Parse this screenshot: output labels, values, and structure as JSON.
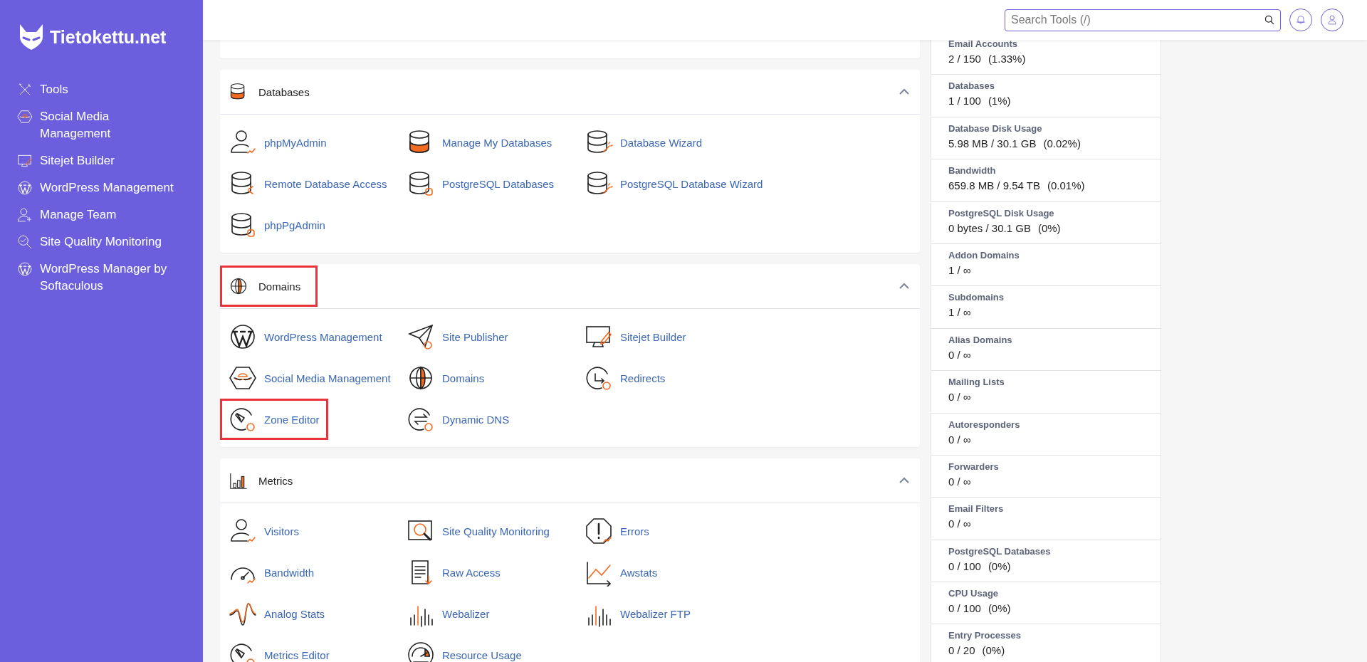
{
  "brand": {
    "name": "Tietokettu.net"
  },
  "sidebar": {
    "items": [
      {
        "label": "Tools"
      },
      {
        "label": "Social Media Management"
      },
      {
        "label": "Sitejet Builder"
      },
      {
        "label": "WordPress Management"
      },
      {
        "label": "Manage Team"
      },
      {
        "label": "Site Quality Monitoring"
      },
      {
        "label": "WordPress Manager by Softaculous"
      }
    ]
  },
  "search": {
    "placeholder": "Search Tools (/)"
  },
  "sections": [
    {
      "title": "Databases",
      "expanded": true,
      "highlighted": false,
      "items": [
        {
          "label": "phpMyAdmin",
          "highlighted": false
        },
        {
          "label": "Manage My Databases",
          "highlighted": false
        },
        {
          "label": "Database Wizard",
          "highlighted": false
        },
        {
          "label": "Remote Database Access",
          "highlighted": false
        },
        {
          "label": "PostgreSQL Databases",
          "highlighted": false
        },
        {
          "label": "PostgreSQL Database Wizard",
          "highlighted": false
        },
        {
          "label": "phpPgAdmin",
          "highlighted": false
        }
      ]
    },
    {
      "title": "Domains",
      "expanded": true,
      "highlighted": true,
      "items": [
        {
          "label": "WordPress Management",
          "highlighted": false
        },
        {
          "label": "Site Publisher",
          "highlighted": false
        },
        {
          "label": "Sitejet Builder",
          "highlighted": false
        },
        {
          "label": "Social Media Management",
          "highlighted": false
        },
        {
          "label": "Domains",
          "highlighted": false
        },
        {
          "label": "Redirects",
          "highlighted": false
        },
        {
          "label": "Zone Editor",
          "highlighted": true
        },
        {
          "label": "Dynamic DNS",
          "highlighted": false
        }
      ]
    },
    {
      "title": "Metrics",
      "expanded": true,
      "highlighted": false,
      "items": [
        {
          "label": "Visitors",
          "highlighted": false
        },
        {
          "label": "Site Quality Monitoring",
          "highlighted": false
        },
        {
          "label": "Errors",
          "highlighted": false
        },
        {
          "label": "Bandwidth",
          "highlighted": false
        },
        {
          "label": "Raw Access",
          "highlighted": false
        },
        {
          "label": "Awstats",
          "highlighted": false
        },
        {
          "label": "Analog Stats",
          "highlighted": false
        },
        {
          "label": "Webalizer",
          "highlighted": false
        },
        {
          "label": "Webalizer FTP",
          "highlighted": false
        },
        {
          "label": "Metrics Editor",
          "highlighted": false
        },
        {
          "label": "Resource Usage",
          "highlighted": false
        }
      ]
    }
  ],
  "statistics": [
    {
      "label": "Email Accounts",
      "usage": "2 / 150",
      "percent": "(1.33%)"
    },
    {
      "label": "Databases",
      "usage": "1 / 100",
      "percent": "(1%)"
    },
    {
      "label": "Database Disk Usage",
      "usage": "5.98 MB / 30.1 GB",
      "percent": "(0.02%)"
    },
    {
      "label": "Bandwidth",
      "usage": "659.8 MB / 9.54 TB",
      "percent": "(0.01%)"
    },
    {
      "label": "PostgreSQL Disk Usage",
      "usage": "0 bytes / 30.1 GB",
      "percent": "(0%)"
    },
    {
      "label": "Addon Domains",
      "usage": "1 / ∞"
    },
    {
      "label": "Subdomains",
      "usage": "1 / ∞"
    },
    {
      "label": "Alias Domains",
      "usage": "0 / ∞"
    },
    {
      "label": "Mailing Lists",
      "usage": "0 / ∞"
    },
    {
      "label": "Autoresponders",
      "usage": "0 / ∞"
    },
    {
      "label": "Forwarders",
      "usage": "0 / ∞"
    },
    {
      "label": "Email Filters",
      "usage": "0 / ∞"
    },
    {
      "label": "PostgreSQL Databases",
      "usage": "0 / 100",
      "percent": "(0%)"
    },
    {
      "label": "CPU Usage",
      "usage": "0 / 100",
      "percent": "(0%)"
    },
    {
      "label": "Entry Processes",
      "usage": "0 / 20",
      "percent": "(0%)"
    }
  ]
}
